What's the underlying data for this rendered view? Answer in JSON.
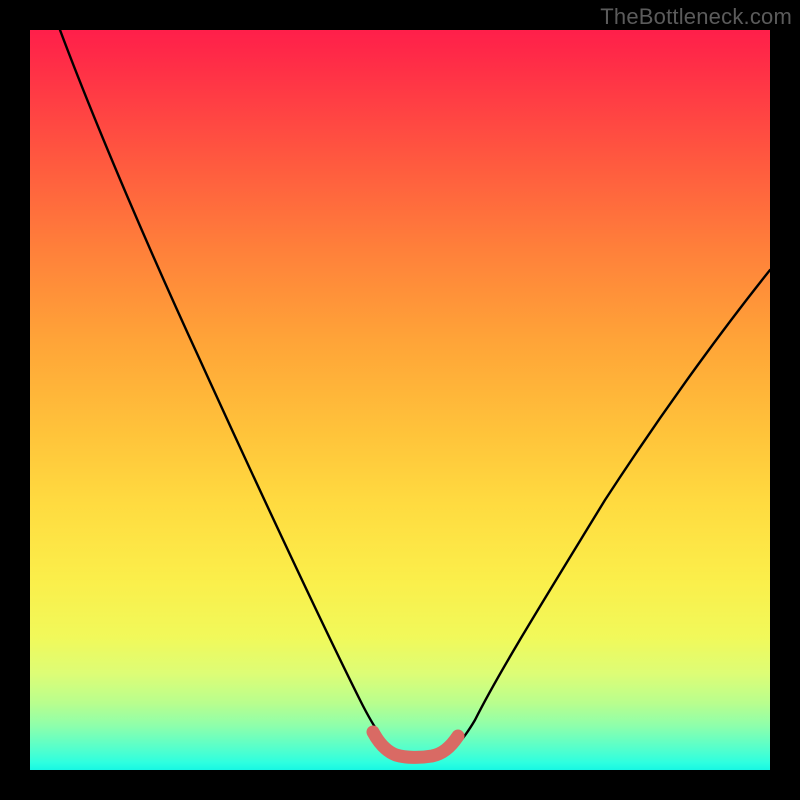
{
  "attribution": "TheBottleneck.com",
  "chart_data": {
    "type": "line",
    "title": "",
    "xlabel": "",
    "ylabel": "",
    "xlim": [
      0,
      100
    ],
    "ylim": [
      0,
      100
    ],
    "series": [
      {
        "name": "bottleneck-curve",
        "x": [
          4,
          10,
          20,
          30,
          38,
          44,
          47,
          49,
          51,
          54,
          56,
          59,
          62,
          68,
          76,
          84,
          92,
          100
        ],
        "y": [
          100,
          87,
          66,
          45,
          28,
          14,
          8,
          3.5,
          2.2,
          2.2,
          3.2,
          7,
          12,
          22,
          35,
          47,
          58,
          68
        ]
      },
      {
        "name": "sweet-spot-band",
        "x": [
          47.5,
          48.5,
          49.5,
          50.5,
          51.5,
          52.5,
          53.5,
          54.5,
          55.5,
          56.5,
          57.5
        ],
        "y": [
          4.2,
          3.0,
          2.4,
          2.2,
          2.2,
          2.3,
          2.5,
          2.8,
          3.3,
          4.0,
          5.0
        ]
      }
    ],
    "colors": {
      "curve": "#000000",
      "band": "#d96a64",
      "frame": "#000000"
    }
  }
}
